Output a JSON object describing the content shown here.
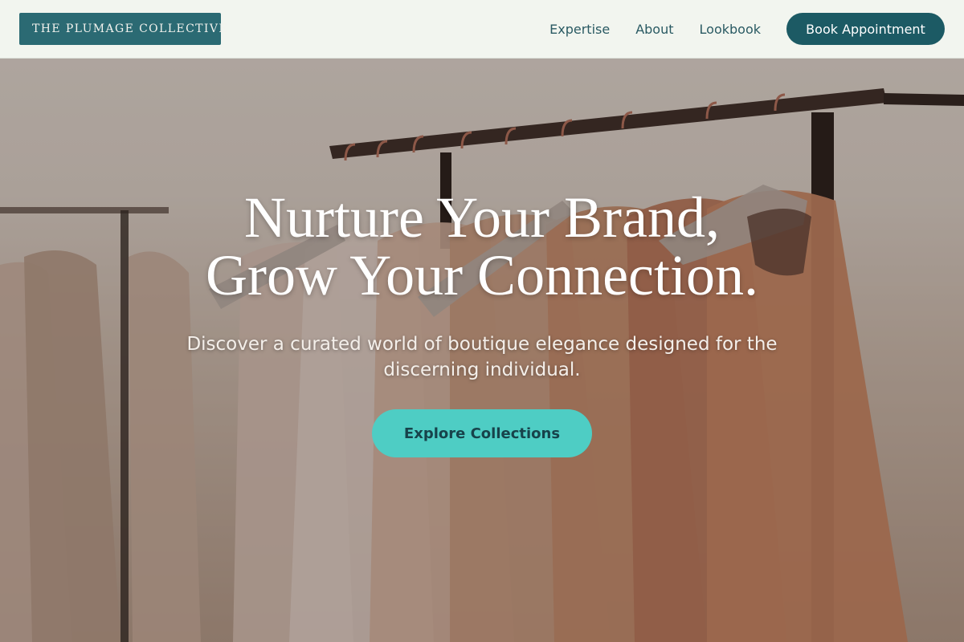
{
  "header": {
    "logo_text": "THE PLUMAGE COLLECTIVE",
    "nav": [
      {
        "label": "Expertise"
      },
      {
        "label": "About"
      },
      {
        "label": "Lookbook"
      }
    ],
    "cta_label": "Book Appointment"
  },
  "hero": {
    "headline_line1": "Nurture Your Brand,",
    "headline_line2": "Grow Your Connection.",
    "subheading": "Discover a curated world of boutique elegance designed for the discerning individual.",
    "cta_label": "Explore Collections",
    "background_image": "clothing-rack-photo"
  },
  "colors": {
    "header_bg": "#f2f5ef",
    "logo_bg": "#2b6a73",
    "nav_text": "#2a5a63",
    "book_button_bg": "#1c5a64",
    "explore_button_bg": "#4ecdc4",
    "explore_button_text": "#17434b"
  }
}
